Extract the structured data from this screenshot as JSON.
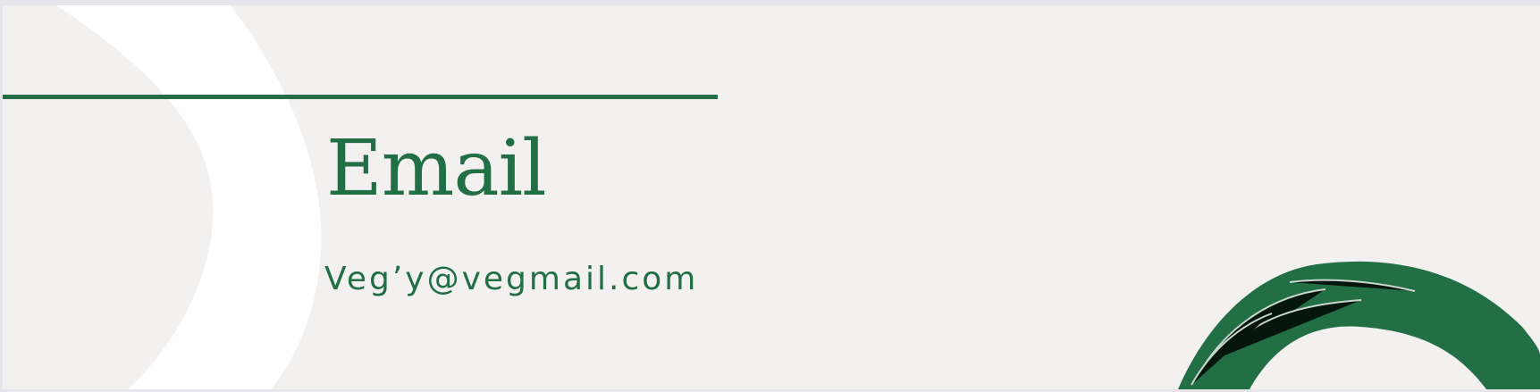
{
  "slide": {
    "title": "Email",
    "email": "Veg’y@vegmail.com"
  },
  "colors": {
    "accent": "#226f45",
    "background": "#f3f0f0",
    "brush_white": "#ffffff"
  }
}
